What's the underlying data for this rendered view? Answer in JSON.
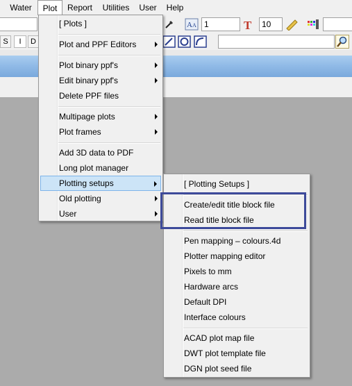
{
  "menubar": {
    "items": [
      {
        "key": "water",
        "label": "Water"
      },
      {
        "key": "plot",
        "label": "Plot"
      },
      {
        "key": "report",
        "label": "Report"
      },
      {
        "key": "utilities",
        "label": "Utilities"
      },
      {
        "key": "user",
        "label": "User"
      },
      {
        "key": "help",
        "label": "Help"
      }
    ]
  },
  "toolbar": {
    "pen_value": "1",
    "text_size_value": "10",
    "buttons": [
      "S",
      "I",
      "D"
    ]
  },
  "plot_menu": {
    "items": [
      {
        "label": "[ Plots ]",
        "submenu": false
      },
      {
        "label": "Plot and PPF Editors",
        "submenu": true
      },
      {
        "label": "Plot binary ppf's",
        "submenu": true
      },
      {
        "label": "Edit binary ppf's",
        "submenu": true
      },
      {
        "label": "Delete PPF files",
        "submenu": false
      },
      {
        "label": "Multipage plots",
        "submenu": true
      },
      {
        "label": "Plot frames",
        "submenu": true
      },
      {
        "label": "Add 3D data to PDF",
        "submenu": false
      },
      {
        "label": "Long plot manager",
        "submenu": false
      },
      {
        "label": "Plotting setups",
        "submenu": true,
        "highlighted": true
      },
      {
        "label": "Old plotting",
        "submenu": true
      },
      {
        "label": "User",
        "submenu": true
      }
    ]
  },
  "setups_menu": {
    "items": [
      {
        "label": "[ Plotting Setups ]"
      },
      {
        "label": "Create/edit title block file"
      },
      {
        "label": "Read title block file"
      },
      {
        "label": "Pen mapping – colours.4d"
      },
      {
        "label": "Plotter mapping editor"
      },
      {
        "label": "Pixels to mm"
      },
      {
        "label": "Hardware arcs"
      },
      {
        "label": "Default DPI"
      },
      {
        "label": "Interface colours"
      },
      {
        "label": "ACAD plot map file"
      },
      {
        "label": "DWT plot template file"
      },
      {
        "label": "DGN plot seed file"
      }
    ]
  },
  "colors": {
    "highlight_bg": "#cce4f7",
    "highlight_border": "#7eb4ea",
    "callout": "#3d4a9a",
    "band": "#8fb9e6"
  }
}
